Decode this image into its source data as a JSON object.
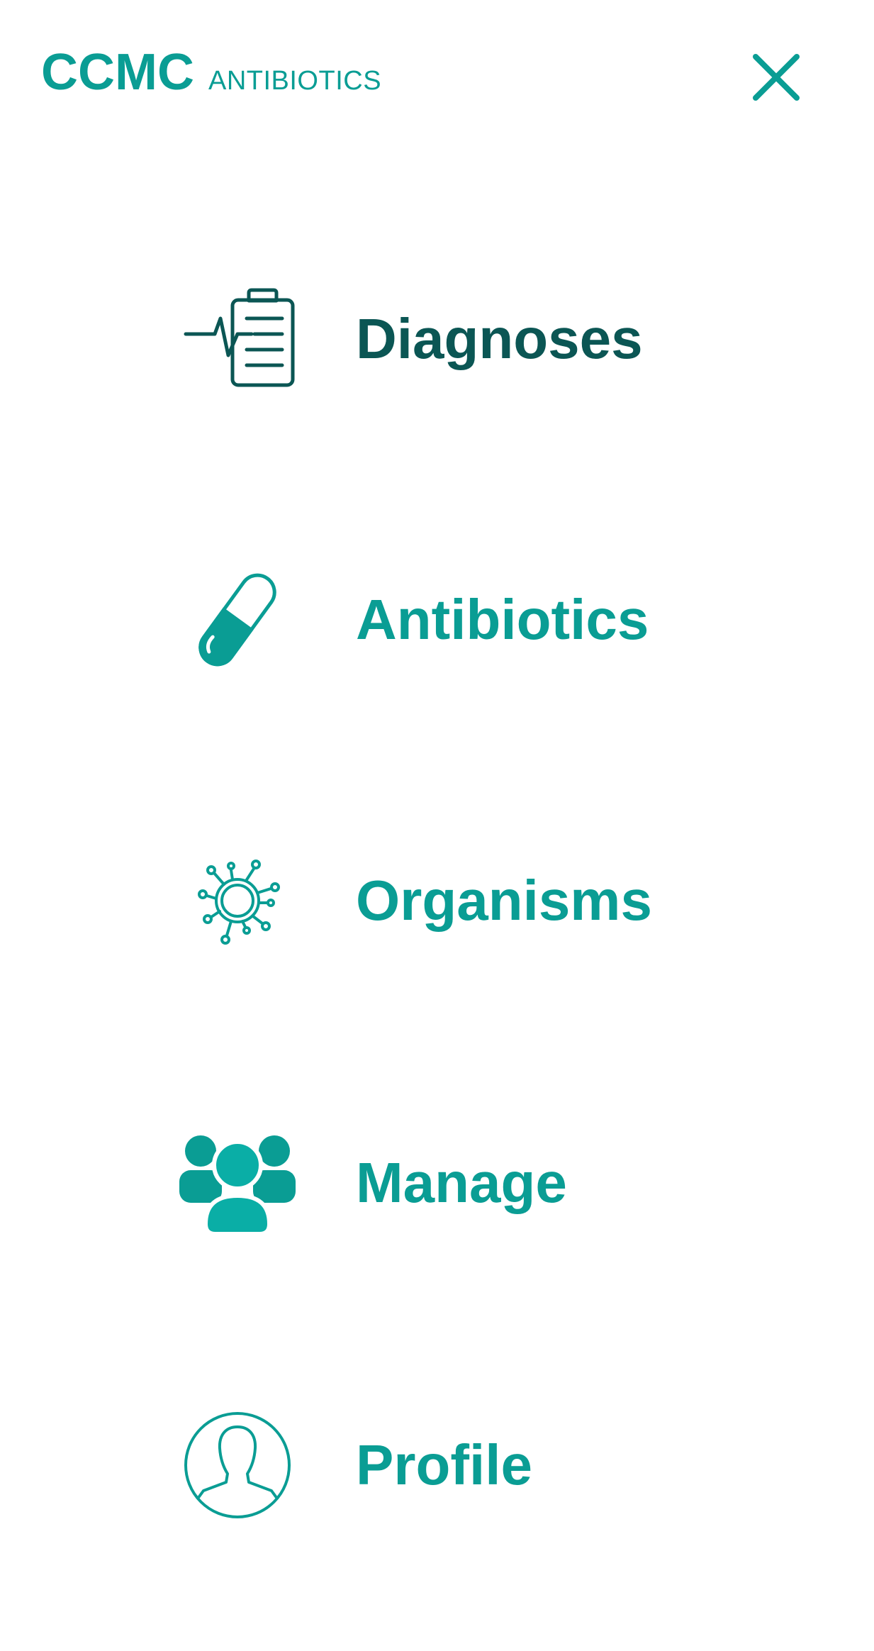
{
  "header": {
    "brand_main": "CCMC",
    "brand_sub": "ANTIBIOTICS",
    "close_icon": "close-icon"
  },
  "colors": {
    "accent": "#0a9d94",
    "active": "#0b5654",
    "background": "#ffffff"
  },
  "menu": {
    "items": [
      {
        "label": "Diagnoses",
        "icon": "clipboard-pulse-icon",
        "active": true
      },
      {
        "label": "Antibiotics",
        "icon": "capsule-icon",
        "active": false
      },
      {
        "label": "Organisms",
        "icon": "virus-icon",
        "active": false
      },
      {
        "label": "Manage",
        "icon": "users-group-icon",
        "active": false
      },
      {
        "label": "Profile",
        "icon": "user-profile-icon",
        "active": false
      }
    ]
  }
}
